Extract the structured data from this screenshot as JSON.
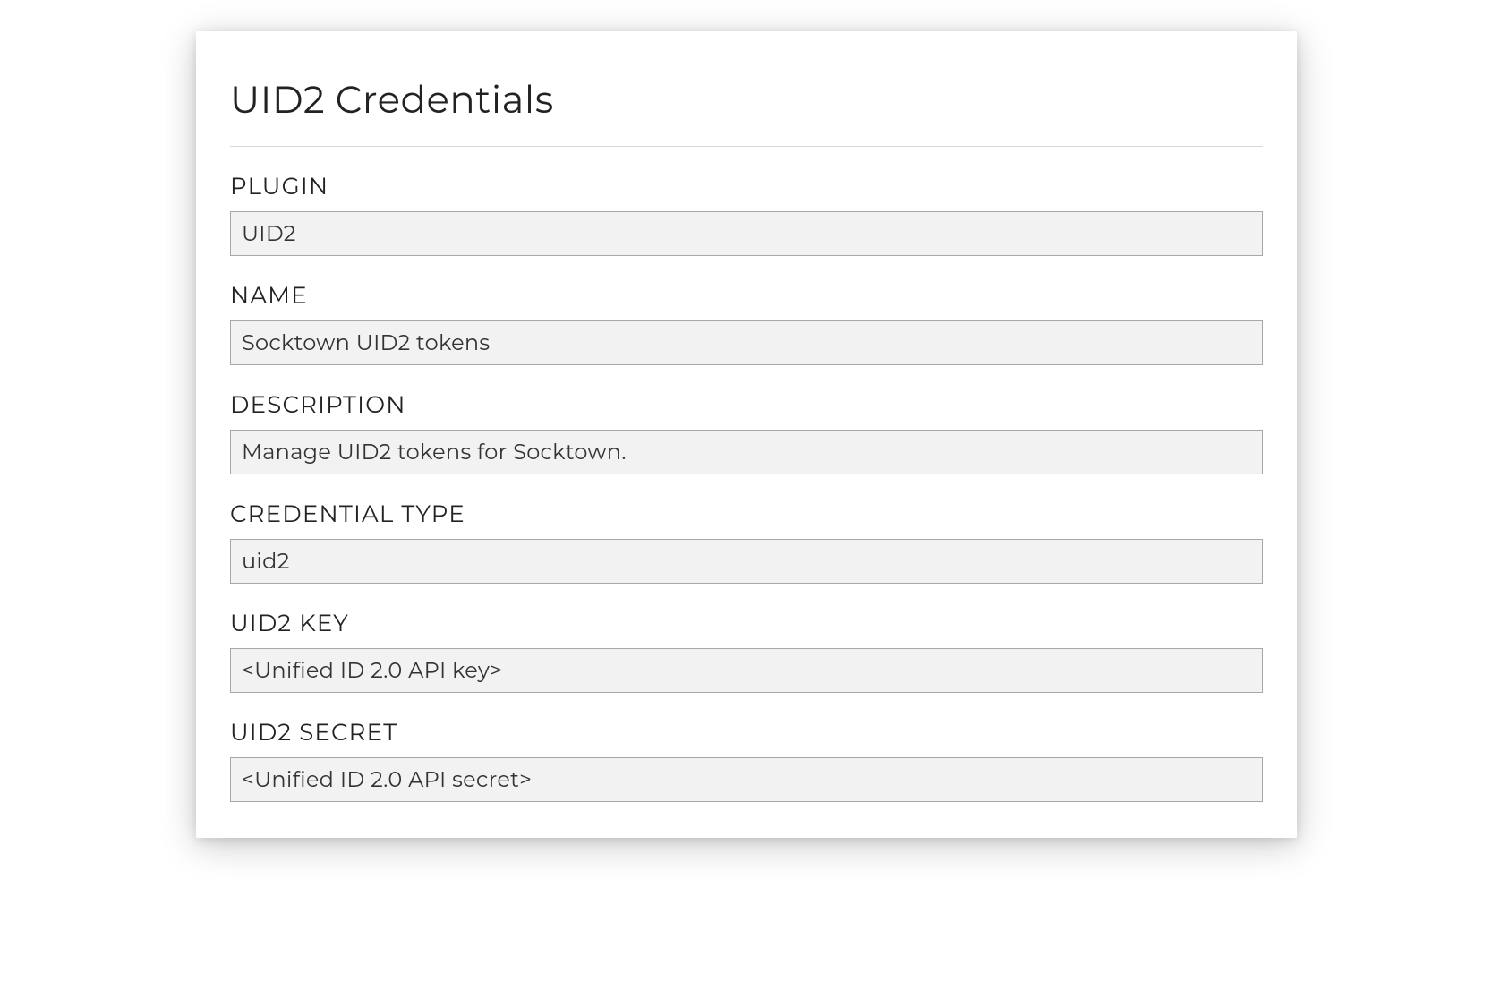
{
  "title": "UID2 Credentials",
  "fields": {
    "plugin": {
      "label": "PLUGIN",
      "value": "UID2"
    },
    "name": {
      "label": "NAME",
      "value": "Socktown UID2 tokens"
    },
    "description": {
      "label": "DESCRIPTION",
      "value": "Manage UID2 tokens for Socktown."
    },
    "credential_type": {
      "label": "CREDENTIAL TYPE",
      "value": "uid2"
    },
    "uid2_key": {
      "label": "UID2 KEY",
      "value": "<Unified ID 2.0 API key>"
    },
    "uid2_secret": {
      "label": "UID2 SECRET",
      "value": "<Unified ID 2.0 API secret>"
    }
  }
}
